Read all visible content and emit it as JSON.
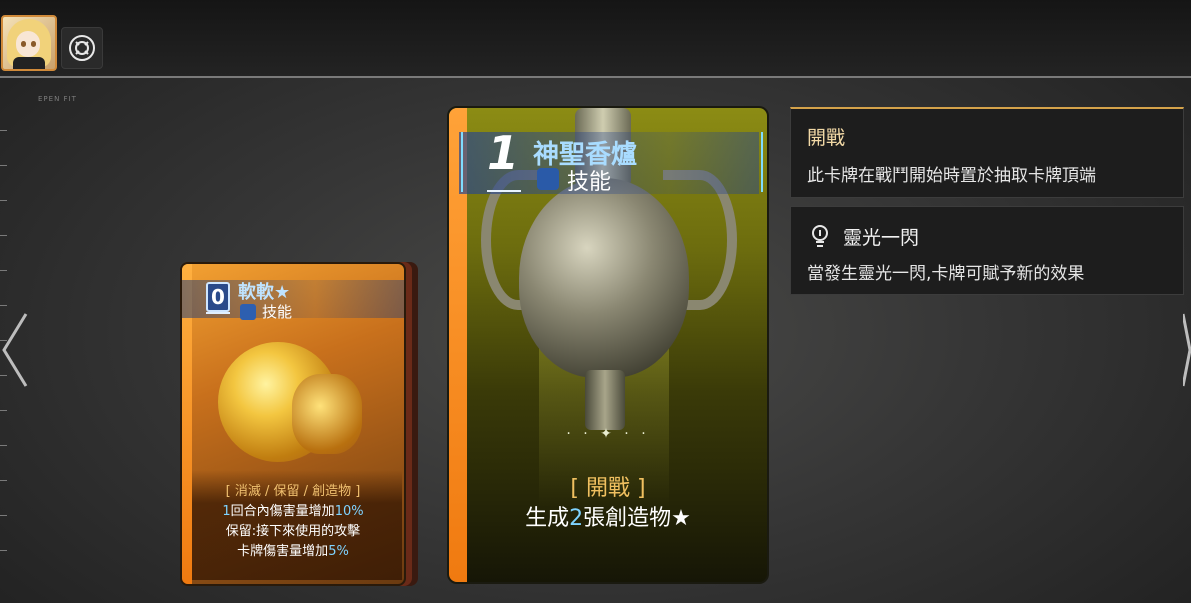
{
  "top_bar": {
    "avatar_icon": "character-avatar",
    "settings_icon": "target-circle-icon"
  },
  "ruler": {
    "label": "EPEN FIT"
  },
  "small_card": {
    "cost": "0",
    "name": "軟軟★",
    "type": "技能",
    "tags": "[ 消滅 / 保留 / 創造物 ]",
    "line1_a": "1",
    "line1_b": "回合內傷害量增加",
    "line1_c": "10%",
    "line2": "保留:接下來使用的攻擊",
    "line3_a": "卡牌傷害量增加",
    "line3_b": "5%"
  },
  "main_card": {
    "cost": "1",
    "name": "神聖香爐",
    "type": "技能",
    "sparkle": "· · ✦ · ·",
    "tag": "[ 開戰 ]",
    "effect_a": "生成",
    "effect_b": "2",
    "effect_c": "張創造物★"
  },
  "tooltips": [
    {
      "title": "開戰",
      "desc": "此卡牌在戰鬥開始時置於抽取卡牌頂端"
    },
    {
      "icon": "lightbulb-icon",
      "title": "靈光一閃",
      "desc": "當發生靈光一閃,卡牌可賦予新的效果"
    }
  ],
  "colors": {
    "accent_orange": "#f07a10",
    "cost_blue": "#7fd3ff",
    "tooltip_title": "#f2d9a6"
  }
}
